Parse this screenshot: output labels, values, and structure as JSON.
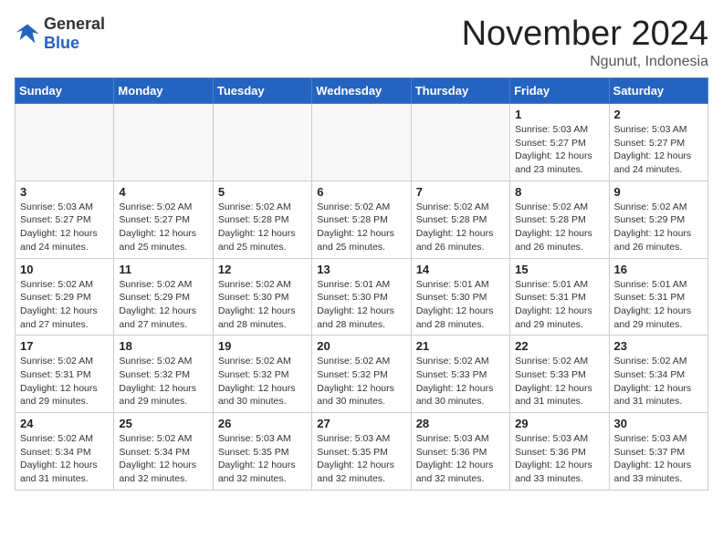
{
  "logo": {
    "general": "General",
    "blue": "Blue"
  },
  "title": "November 2024",
  "location": "Ngunut, Indonesia",
  "days_of_week": [
    "Sunday",
    "Monday",
    "Tuesday",
    "Wednesday",
    "Thursday",
    "Friday",
    "Saturday"
  ],
  "weeks": [
    [
      {
        "day": "",
        "info": ""
      },
      {
        "day": "",
        "info": ""
      },
      {
        "day": "",
        "info": ""
      },
      {
        "day": "",
        "info": ""
      },
      {
        "day": "",
        "info": ""
      },
      {
        "day": "1",
        "info": "Sunrise: 5:03 AM\nSunset: 5:27 PM\nDaylight: 12 hours\nand 23 minutes."
      },
      {
        "day": "2",
        "info": "Sunrise: 5:03 AM\nSunset: 5:27 PM\nDaylight: 12 hours\nand 24 minutes."
      }
    ],
    [
      {
        "day": "3",
        "info": "Sunrise: 5:03 AM\nSunset: 5:27 PM\nDaylight: 12 hours\nand 24 minutes."
      },
      {
        "day": "4",
        "info": "Sunrise: 5:02 AM\nSunset: 5:27 PM\nDaylight: 12 hours\nand 25 minutes."
      },
      {
        "day": "5",
        "info": "Sunrise: 5:02 AM\nSunset: 5:28 PM\nDaylight: 12 hours\nand 25 minutes."
      },
      {
        "day": "6",
        "info": "Sunrise: 5:02 AM\nSunset: 5:28 PM\nDaylight: 12 hours\nand 25 minutes."
      },
      {
        "day": "7",
        "info": "Sunrise: 5:02 AM\nSunset: 5:28 PM\nDaylight: 12 hours\nand 26 minutes."
      },
      {
        "day": "8",
        "info": "Sunrise: 5:02 AM\nSunset: 5:28 PM\nDaylight: 12 hours\nand 26 minutes."
      },
      {
        "day": "9",
        "info": "Sunrise: 5:02 AM\nSunset: 5:29 PM\nDaylight: 12 hours\nand 26 minutes."
      }
    ],
    [
      {
        "day": "10",
        "info": "Sunrise: 5:02 AM\nSunset: 5:29 PM\nDaylight: 12 hours\nand 27 minutes."
      },
      {
        "day": "11",
        "info": "Sunrise: 5:02 AM\nSunset: 5:29 PM\nDaylight: 12 hours\nand 27 minutes."
      },
      {
        "day": "12",
        "info": "Sunrise: 5:02 AM\nSunset: 5:30 PM\nDaylight: 12 hours\nand 28 minutes."
      },
      {
        "day": "13",
        "info": "Sunrise: 5:01 AM\nSunset: 5:30 PM\nDaylight: 12 hours\nand 28 minutes."
      },
      {
        "day": "14",
        "info": "Sunrise: 5:01 AM\nSunset: 5:30 PM\nDaylight: 12 hours\nand 28 minutes."
      },
      {
        "day": "15",
        "info": "Sunrise: 5:01 AM\nSunset: 5:31 PM\nDaylight: 12 hours\nand 29 minutes."
      },
      {
        "day": "16",
        "info": "Sunrise: 5:01 AM\nSunset: 5:31 PM\nDaylight: 12 hours\nand 29 minutes."
      }
    ],
    [
      {
        "day": "17",
        "info": "Sunrise: 5:02 AM\nSunset: 5:31 PM\nDaylight: 12 hours\nand 29 minutes."
      },
      {
        "day": "18",
        "info": "Sunrise: 5:02 AM\nSunset: 5:32 PM\nDaylight: 12 hours\nand 29 minutes."
      },
      {
        "day": "19",
        "info": "Sunrise: 5:02 AM\nSunset: 5:32 PM\nDaylight: 12 hours\nand 30 minutes."
      },
      {
        "day": "20",
        "info": "Sunrise: 5:02 AM\nSunset: 5:32 PM\nDaylight: 12 hours\nand 30 minutes."
      },
      {
        "day": "21",
        "info": "Sunrise: 5:02 AM\nSunset: 5:33 PM\nDaylight: 12 hours\nand 30 minutes."
      },
      {
        "day": "22",
        "info": "Sunrise: 5:02 AM\nSunset: 5:33 PM\nDaylight: 12 hours\nand 31 minutes."
      },
      {
        "day": "23",
        "info": "Sunrise: 5:02 AM\nSunset: 5:34 PM\nDaylight: 12 hours\nand 31 minutes."
      }
    ],
    [
      {
        "day": "24",
        "info": "Sunrise: 5:02 AM\nSunset: 5:34 PM\nDaylight: 12 hours\nand 31 minutes."
      },
      {
        "day": "25",
        "info": "Sunrise: 5:02 AM\nSunset: 5:34 PM\nDaylight: 12 hours\nand 32 minutes."
      },
      {
        "day": "26",
        "info": "Sunrise: 5:03 AM\nSunset: 5:35 PM\nDaylight: 12 hours\nand 32 minutes."
      },
      {
        "day": "27",
        "info": "Sunrise: 5:03 AM\nSunset: 5:35 PM\nDaylight: 12 hours\nand 32 minutes."
      },
      {
        "day": "28",
        "info": "Sunrise: 5:03 AM\nSunset: 5:36 PM\nDaylight: 12 hours\nand 32 minutes."
      },
      {
        "day": "29",
        "info": "Sunrise: 5:03 AM\nSunset: 5:36 PM\nDaylight: 12 hours\nand 33 minutes."
      },
      {
        "day": "30",
        "info": "Sunrise: 5:03 AM\nSunset: 5:37 PM\nDaylight: 12 hours\nand 33 minutes."
      }
    ]
  ]
}
